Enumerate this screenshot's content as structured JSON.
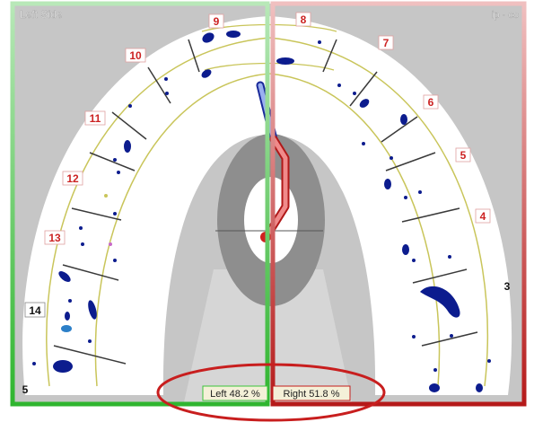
{
  "view": {
    "left_title": "Left Side",
    "right_corner_text": "ip · co"
  },
  "colors": {
    "background_gray": "#c8c8c8",
    "arch_fill": "#ffffff",
    "tooth_outline": "#c8c45a",
    "left_border": "#3bc43b",
    "right_border": "#c41c1c",
    "contact_mark": "#0a1a8c",
    "ring": "#8c8c8c",
    "highlight_ellipse": "#c81e1e",
    "label_text": "#cc2222"
  },
  "teeth": {
    "left": [
      "9",
      "10",
      "11",
      "12",
      "13",
      "14",
      "5"
    ],
    "right": [
      "8",
      "7",
      "6",
      "5",
      "4",
      "3"
    ]
  },
  "status": {
    "left_percent": "Left 48.2 %",
    "right_percent": "Right 51.8 %"
  }
}
